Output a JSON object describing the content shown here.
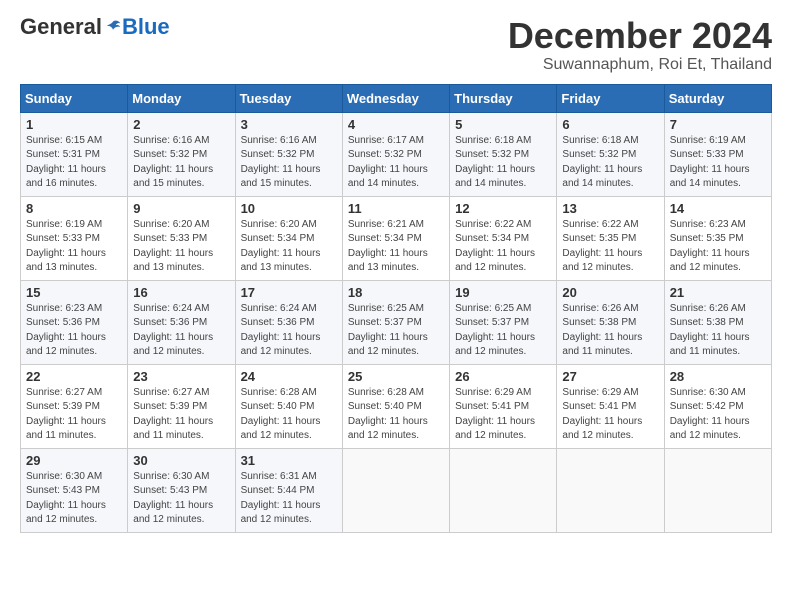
{
  "header": {
    "logo_general": "General",
    "logo_blue": "Blue",
    "month_title": "December 2024",
    "subtitle": "Suwannaphum, Roi Et, Thailand"
  },
  "days_of_week": [
    "Sunday",
    "Monday",
    "Tuesday",
    "Wednesday",
    "Thursday",
    "Friday",
    "Saturday"
  ],
  "weeks": [
    [
      {
        "day": "1",
        "sunrise": "6:15 AM",
        "sunset": "5:31 PM",
        "daylight": "11 hours and 16 minutes."
      },
      {
        "day": "2",
        "sunrise": "6:16 AM",
        "sunset": "5:32 PM",
        "daylight": "11 hours and 15 minutes."
      },
      {
        "day": "3",
        "sunrise": "6:16 AM",
        "sunset": "5:32 PM",
        "daylight": "11 hours and 15 minutes."
      },
      {
        "day": "4",
        "sunrise": "6:17 AM",
        "sunset": "5:32 PM",
        "daylight": "11 hours and 14 minutes."
      },
      {
        "day": "5",
        "sunrise": "6:18 AM",
        "sunset": "5:32 PM",
        "daylight": "11 hours and 14 minutes."
      },
      {
        "day": "6",
        "sunrise": "6:18 AM",
        "sunset": "5:32 PM",
        "daylight": "11 hours and 14 minutes."
      },
      {
        "day": "7",
        "sunrise": "6:19 AM",
        "sunset": "5:33 PM",
        "daylight": "11 hours and 14 minutes."
      }
    ],
    [
      {
        "day": "8",
        "sunrise": "6:19 AM",
        "sunset": "5:33 PM",
        "daylight": "11 hours and 13 minutes."
      },
      {
        "day": "9",
        "sunrise": "6:20 AM",
        "sunset": "5:33 PM",
        "daylight": "11 hours and 13 minutes."
      },
      {
        "day": "10",
        "sunrise": "6:20 AM",
        "sunset": "5:34 PM",
        "daylight": "11 hours and 13 minutes."
      },
      {
        "day": "11",
        "sunrise": "6:21 AM",
        "sunset": "5:34 PM",
        "daylight": "11 hours and 13 minutes."
      },
      {
        "day": "12",
        "sunrise": "6:22 AM",
        "sunset": "5:34 PM",
        "daylight": "11 hours and 12 minutes."
      },
      {
        "day": "13",
        "sunrise": "6:22 AM",
        "sunset": "5:35 PM",
        "daylight": "11 hours and 12 minutes."
      },
      {
        "day": "14",
        "sunrise": "6:23 AM",
        "sunset": "5:35 PM",
        "daylight": "11 hours and 12 minutes."
      }
    ],
    [
      {
        "day": "15",
        "sunrise": "6:23 AM",
        "sunset": "5:36 PM",
        "daylight": "11 hours and 12 minutes."
      },
      {
        "day": "16",
        "sunrise": "6:24 AM",
        "sunset": "5:36 PM",
        "daylight": "11 hours and 12 minutes."
      },
      {
        "day": "17",
        "sunrise": "6:24 AM",
        "sunset": "5:36 PM",
        "daylight": "11 hours and 12 minutes."
      },
      {
        "day": "18",
        "sunrise": "6:25 AM",
        "sunset": "5:37 PM",
        "daylight": "11 hours and 12 minutes."
      },
      {
        "day": "19",
        "sunrise": "6:25 AM",
        "sunset": "5:37 PM",
        "daylight": "11 hours and 12 minutes."
      },
      {
        "day": "20",
        "sunrise": "6:26 AM",
        "sunset": "5:38 PM",
        "daylight": "11 hours and 11 minutes."
      },
      {
        "day": "21",
        "sunrise": "6:26 AM",
        "sunset": "5:38 PM",
        "daylight": "11 hours and 11 minutes."
      }
    ],
    [
      {
        "day": "22",
        "sunrise": "6:27 AM",
        "sunset": "5:39 PM",
        "daylight": "11 hours and 11 minutes."
      },
      {
        "day": "23",
        "sunrise": "6:27 AM",
        "sunset": "5:39 PM",
        "daylight": "11 hours and 11 minutes."
      },
      {
        "day": "24",
        "sunrise": "6:28 AM",
        "sunset": "5:40 PM",
        "daylight": "11 hours and 12 minutes."
      },
      {
        "day": "25",
        "sunrise": "6:28 AM",
        "sunset": "5:40 PM",
        "daylight": "11 hours and 12 minutes."
      },
      {
        "day": "26",
        "sunrise": "6:29 AM",
        "sunset": "5:41 PM",
        "daylight": "11 hours and 12 minutes."
      },
      {
        "day": "27",
        "sunrise": "6:29 AM",
        "sunset": "5:41 PM",
        "daylight": "11 hours and 12 minutes."
      },
      {
        "day": "28",
        "sunrise": "6:30 AM",
        "sunset": "5:42 PM",
        "daylight": "11 hours and 12 minutes."
      }
    ],
    [
      {
        "day": "29",
        "sunrise": "6:30 AM",
        "sunset": "5:43 PM",
        "daylight": "11 hours and 12 minutes."
      },
      {
        "day": "30",
        "sunrise": "6:30 AM",
        "sunset": "5:43 PM",
        "daylight": "11 hours and 12 minutes."
      },
      {
        "day": "31",
        "sunrise": "6:31 AM",
        "sunset": "5:44 PM",
        "daylight": "11 hours and 12 minutes."
      },
      null,
      null,
      null,
      null
    ]
  ]
}
